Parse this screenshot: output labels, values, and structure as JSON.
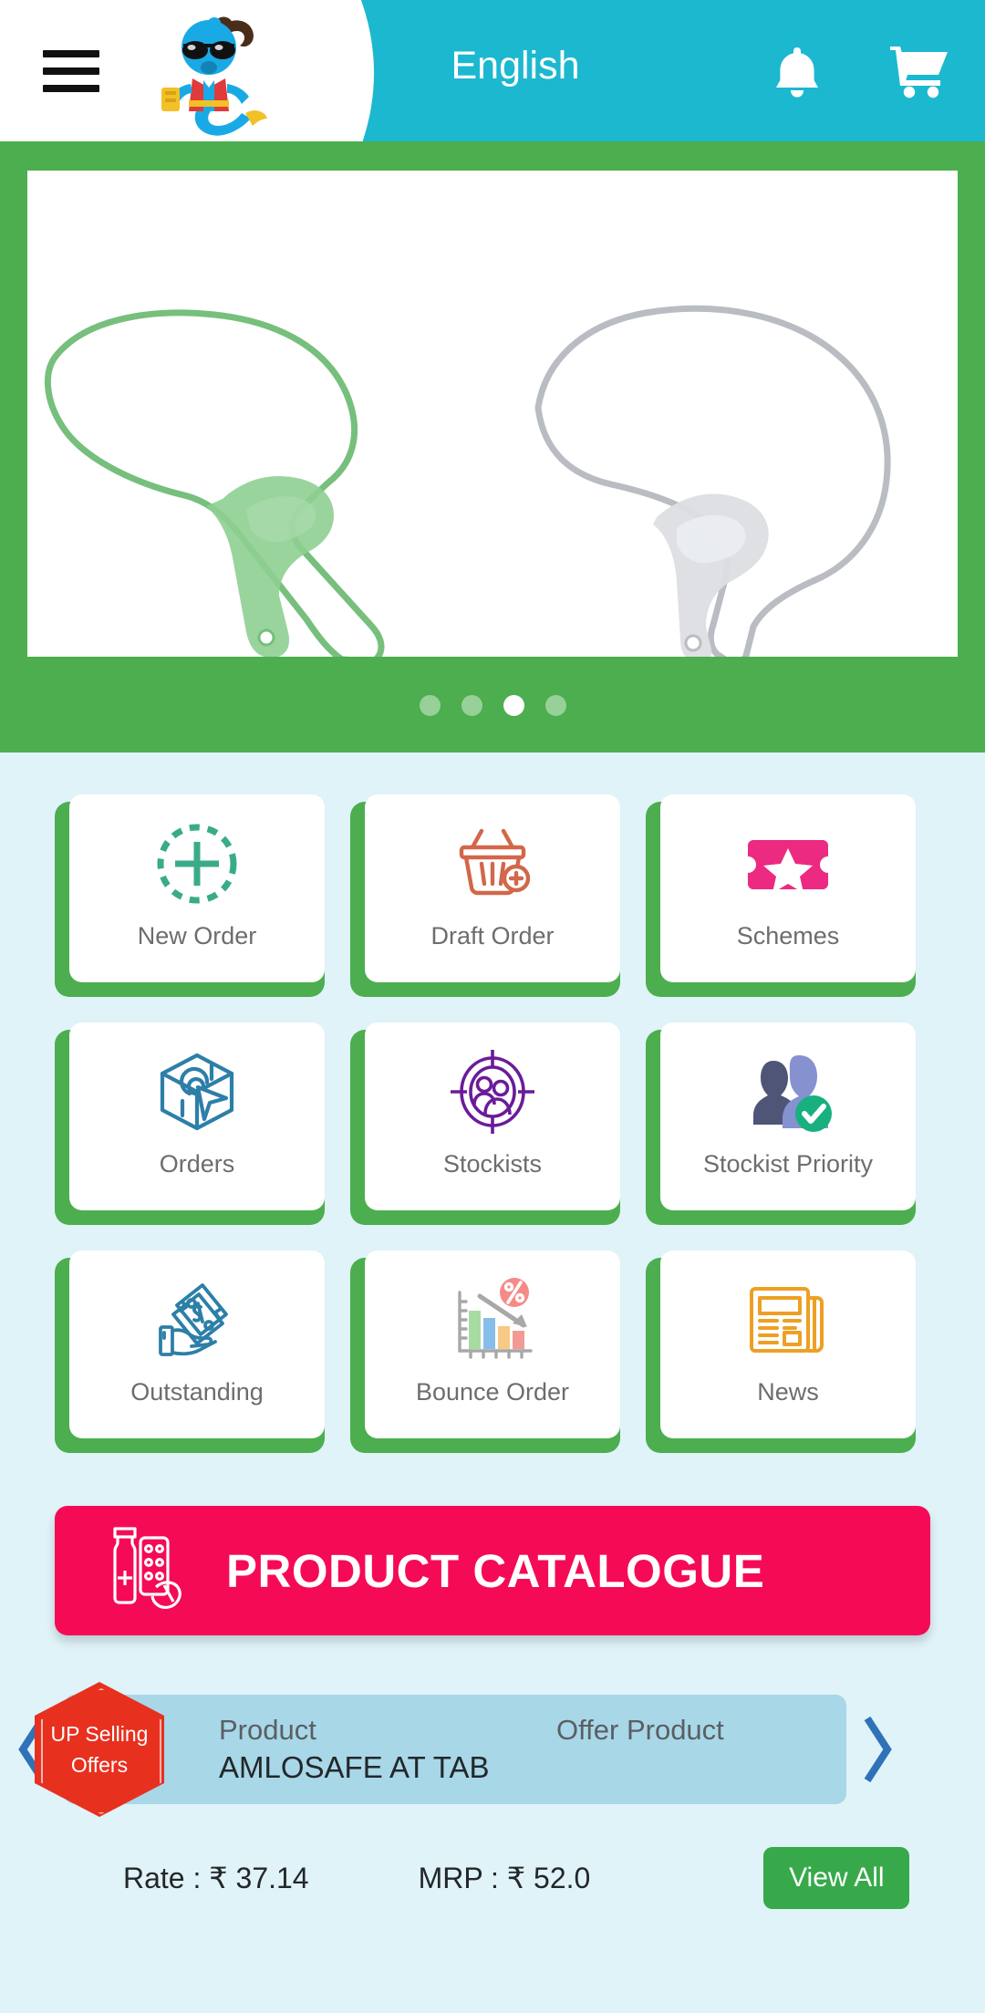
{
  "header": {
    "menu_icon": "hamburger-menu-icon",
    "logo": "mascot-genie-logo",
    "language": "English",
    "bell_icon": "notification-bell-icon",
    "cart_icon": "shopping-cart-icon"
  },
  "hero": {
    "image_alt": "dental-intraoral-mirrors",
    "dots": 4,
    "active_dot": 3
  },
  "grid": {
    "tiles": [
      {
        "label": "New Order",
        "icon": "plus-circle-dashed-icon",
        "color": "#3aab8a"
      },
      {
        "label": "Draft Order",
        "icon": "basket-plus-icon",
        "color": "#d2674a"
      },
      {
        "label": "Schemes",
        "icon": "ticket-star-icon",
        "color": "#ec2a82"
      },
      {
        "label": "Orders",
        "icon": "box-cursor-icon",
        "color": "#2d7fa8"
      },
      {
        "label": "Stockists",
        "icon": "target-people-icon",
        "color": "#6a1b9a"
      },
      {
        "label": "Stockist Priority",
        "icon": "users-check-icon",
        "color": "#7d86c9"
      },
      {
        "label": "Outstanding",
        "icon": "hand-money-icon",
        "color": "#2d7fa8"
      },
      {
        "label": "Bounce Order",
        "icon": "declining-chart-percent-icon",
        "color": "#9e9e9e"
      },
      {
        "label": "News",
        "icon": "newspaper-icon",
        "color": "#eda023"
      }
    ]
  },
  "catalogue": {
    "label": "PRODUCT CATALOGUE",
    "icon": "medicine-bottle-pills-icon",
    "color": "#f50a55"
  },
  "offers": {
    "prev_icon": "chevron-left-icon",
    "next_icon": "chevron-right-icon",
    "badge_line1": "UP Selling",
    "badge_line2": "Offers",
    "product_header": "Product",
    "product_value": "AMLOSAFE AT TAB",
    "offer_product_header": "Offer Product",
    "offer_product_value": "",
    "rate": "Rate : ₹ 37.14",
    "mrp": "MRP : ₹ 52.0",
    "view_all": "View All"
  },
  "colors": {
    "header_teal": "#1cb8cf",
    "banner_green": "#4cae4f",
    "page_bg": "#dff3f8",
    "catalogue_pink": "#f50a55",
    "button_green": "#37a94a",
    "chevron_blue": "#2f72b8",
    "offer_card_blue": "#a8d7e8",
    "badge_red": "#e8301f"
  }
}
